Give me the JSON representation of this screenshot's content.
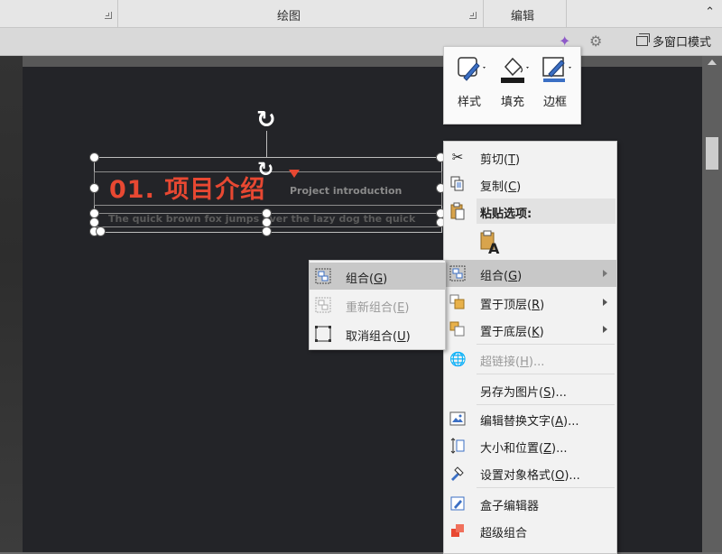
{
  "ribbon": {
    "groups": [
      {
        "label": "绘图"
      },
      {
        "label": "编辑"
      }
    ],
    "collapse_symbol": "⌃"
  },
  "toolbar": {
    "multi_window_label": "多窗口模式"
  },
  "slide": {
    "title": "01. 项目介绍",
    "subtitle": "Project introduction",
    "body": "The quick brown fox jumps over the lazy dog the quick"
  },
  "mini_toolbar": {
    "items": [
      {
        "label": "样式",
        "icon": "shape-style-icon"
      },
      {
        "label": "填充",
        "icon": "fill-bucket-icon"
      },
      {
        "label": "边框",
        "icon": "outline-pen-icon"
      }
    ]
  },
  "context_menu": {
    "items": [
      {
        "label": "剪切",
        "key": "T",
        "icon": "scissors-icon"
      },
      {
        "label": "复制",
        "key": "C",
        "icon": "copy-icon"
      },
      {
        "label": "粘贴选项:",
        "icon": "paste-icon"
      },
      {
        "label": "组合",
        "key": "G",
        "icon": "group-icon"
      },
      {
        "label": "置于顶层",
        "key": "R",
        "icon": "bring-to-front-icon"
      },
      {
        "label": "置于底层",
        "key": "K",
        "icon": "send-to-back-icon"
      },
      {
        "label": "超链接",
        "key": "H",
        "suffix": "...",
        "icon": "hyperlink-icon"
      },
      {
        "label": "另存为图片",
        "key": "S",
        "suffix": "..."
      },
      {
        "label": "编辑替换文字",
        "key": "A",
        "suffix": "...",
        "icon": "alt-text-icon"
      },
      {
        "label": "大小和位置",
        "key": "Z",
        "suffix": "...",
        "icon": "size-position-icon"
      },
      {
        "label": "设置对象格式",
        "key": "O",
        "suffix": "...",
        "icon": "format-object-icon"
      },
      {
        "label": "盒子编辑器",
        "icon": "box-editor-icon"
      },
      {
        "label": "超级组合",
        "icon": "super-group-icon"
      }
    ]
  },
  "submenu": {
    "items": [
      {
        "label": "组合",
        "key": "G"
      },
      {
        "label": "重新组合",
        "key": "E"
      },
      {
        "label": "取消组合",
        "key": "U"
      }
    ]
  },
  "colors": {
    "title_red": "#e84832",
    "slide_bg": "#232428",
    "menu_bg": "#f2f2f2",
    "menu_highlight": "#c8c8c8"
  }
}
